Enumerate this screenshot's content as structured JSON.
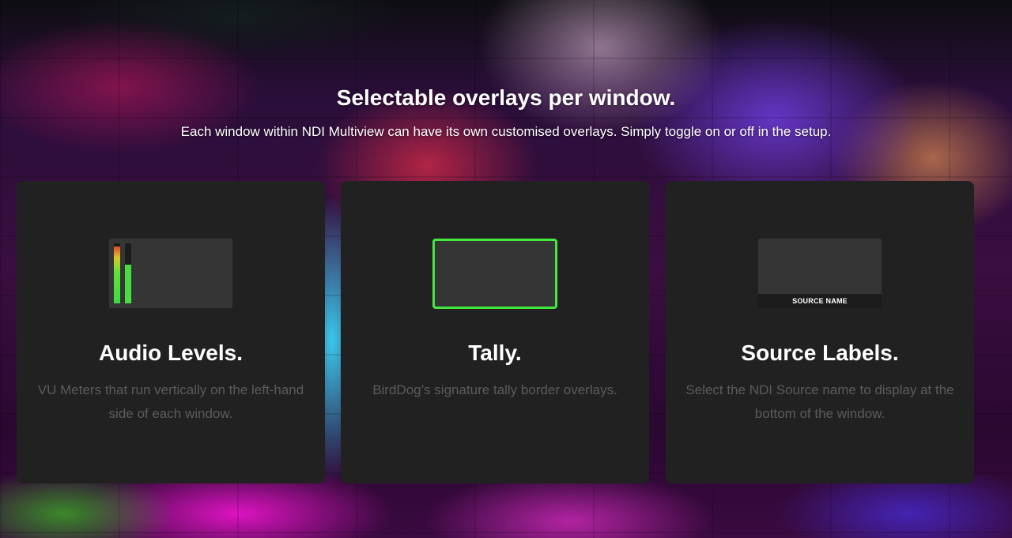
{
  "headline": "Selectable overlays per window.",
  "subheadline": "Each window within NDI Multiview can have its own customised overlays. Simply toggle on or off in the setup.",
  "cards": [
    {
      "title": "Audio Levels.",
      "description": "VU Meters that run vertically on the left-hand side of each window.",
      "preview": {
        "left_meter_level": 0.95,
        "right_meter_level": 0.64
      }
    },
    {
      "title": "Tally.",
      "description": "BirdDog’s signature tally border overlays.",
      "preview": {
        "tally_color": "#44e83e"
      }
    },
    {
      "title": "Source Labels.",
      "description": "Select the NDI Source name to display at the bottom of the window.",
      "preview": {
        "label_text": "SOURCE NAME"
      }
    }
  ]
}
